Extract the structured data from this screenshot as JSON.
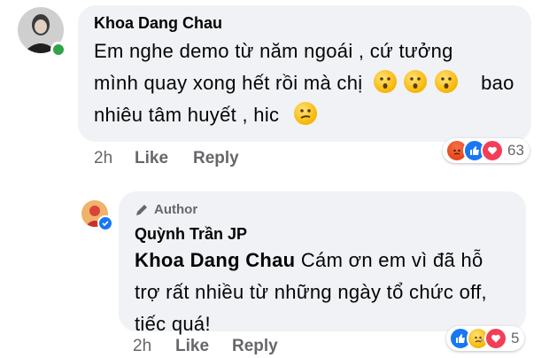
{
  "comment": {
    "author": "Khoa Dang Chau",
    "lines": [
      "Em nghe demo từ năm ngoái , cứ tưởng",
      "mình quay xong hết rồi mà chị",
      "bao",
      "nhiêu tâm huyết , hic"
    ],
    "time": "2h",
    "like_label": "Like",
    "reply_label": "Reply",
    "reaction_count": "63",
    "reactions": [
      "angry-icon",
      "like-icon",
      "love-icon"
    ]
  },
  "reply": {
    "badge_label": "Author",
    "author": "Quỳnh Trần JP",
    "mention": "Khoa Dang Chau",
    "lines": [
      " Cám ơn em vì đã hỗ",
      "trợ rất nhiều từ những ngày tổ chức off,",
      "tiếc quá!"
    ],
    "time": "2h",
    "like_label": "Like",
    "reply_label": "Reply",
    "reaction_count": "5",
    "reactions": [
      "like-icon",
      "sad-icon",
      "love-icon"
    ]
  },
  "colors": {
    "bubble": "#f0f2f5",
    "meta": "#65676b",
    "like_blue": "#1877f2",
    "love_red": "#f33e58",
    "online_green": "#31a24c"
  }
}
